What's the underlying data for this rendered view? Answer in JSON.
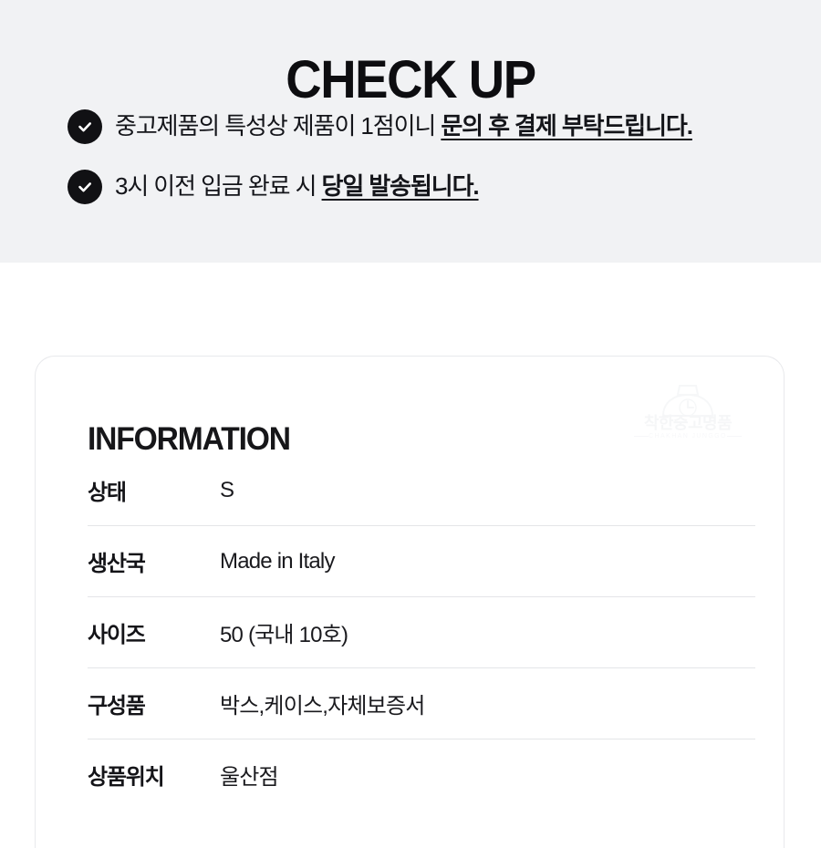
{
  "checkup": {
    "title": "CHECK UP",
    "bullets": [
      {
        "icon": "check-circle-icon",
        "normal": "중고제품의 특성상 제품이 1점이니 ",
        "emphasis": "문의 후 결제 부탁드립니다."
      },
      {
        "icon": "check-circle-icon",
        "normal": "3시 이전 입금 완료 시 ",
        "emphasis": "당일 발송됩니다."
      }
    ],
    "background_color": "#f1f2f4",
    "icon_color": "#111114"
  },
  "information": {
    "title": "INFORMATION",
    "watermark": {
      "name": "착한중고명품",
      "subtitle": "CHAKHAN JUNGGO",
      "mark": "shop-bag-icon"
    },
    "rows": [
      {
        "label": "상태",
        "value": "S"
      },
      {
        "label": "생산국",
        "value": "Made in Italy"
      },
      {
        "label": "사이즈",
        "value": "50 (국내 10호)"
      },
      {
        "label": "구성품",
        "value": "박스,케이스,자체보증서"
      },
      {
        "label": "상품위치",
        "value": "울산점"
      }
    ]
  },
  "colors": {
    "text": "#14151a",
    "divider": "#e4e5e8",
    "card_border": "#e8e9ec",
    "page_background": "#ffffff"
  }
}
